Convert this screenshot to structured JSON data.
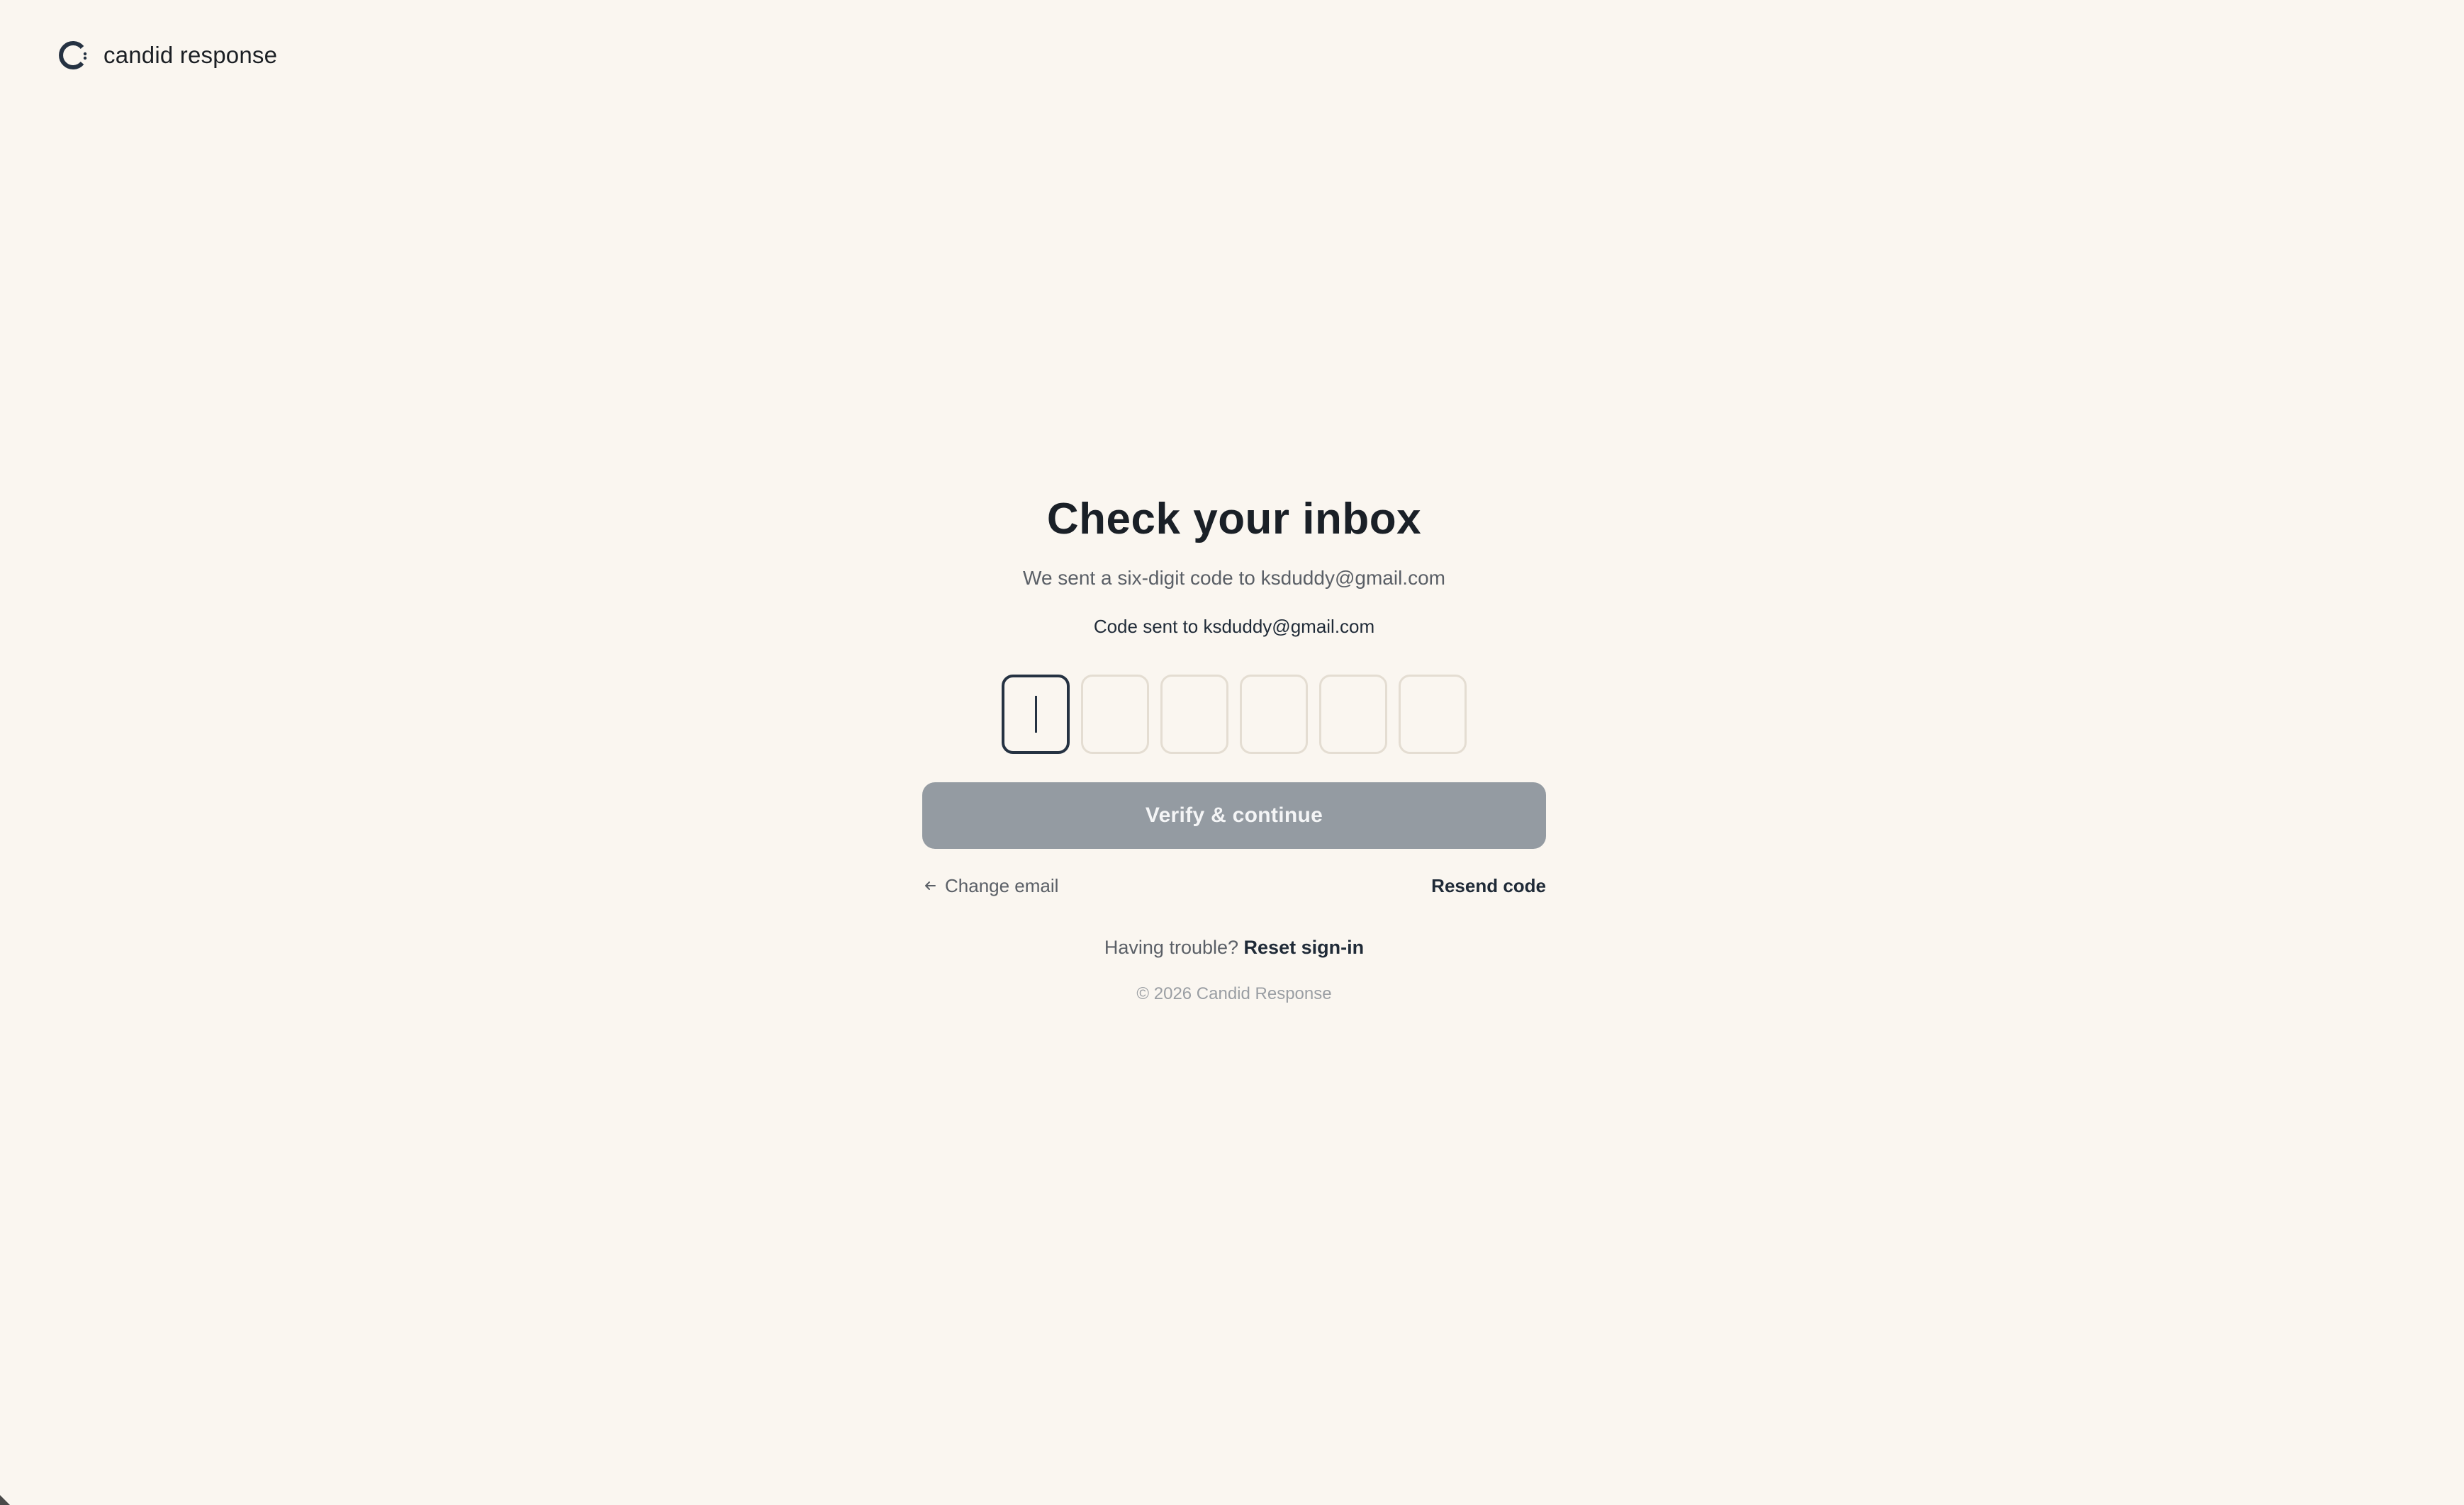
{
  "brand": {
    "name": "candid response",
    "logo_icon": "circular-c-logo-icon"
  },
  "colors": {
    "background": "#faf6f0",
    "primary_dark": "#253242",
    "button_disabled": "#949ba2",
    "box_border": "#e4ddd2"
  },
  "main": {
    "title": "Check your inbox",
    "subtitle": "We sent a six-digit code to ksduddy@gmail.com",
    "code_note": "Code sent to ksduddy@gmail.com",
    "otp": {
      "length": 6,
      "values": [
        "",
        "",
        "",
        "",
        "",
        ""
      ],
      "active_index": 0
    },
    "verify_button": {
      "label": "Verify & continue",
      "state": "disabled"
    },
    "change_email": {
      "label": "Change email",
      "icon": "arrow-left-icon"
    },
    "resend_code": {
      "label": "Resend code"
    },
    "trouble": {
      "prefix": "Having trouble?",
      "link": "Reset sign-in"
    },
    "footer": "© 2026 Candid Response"
  }
}
